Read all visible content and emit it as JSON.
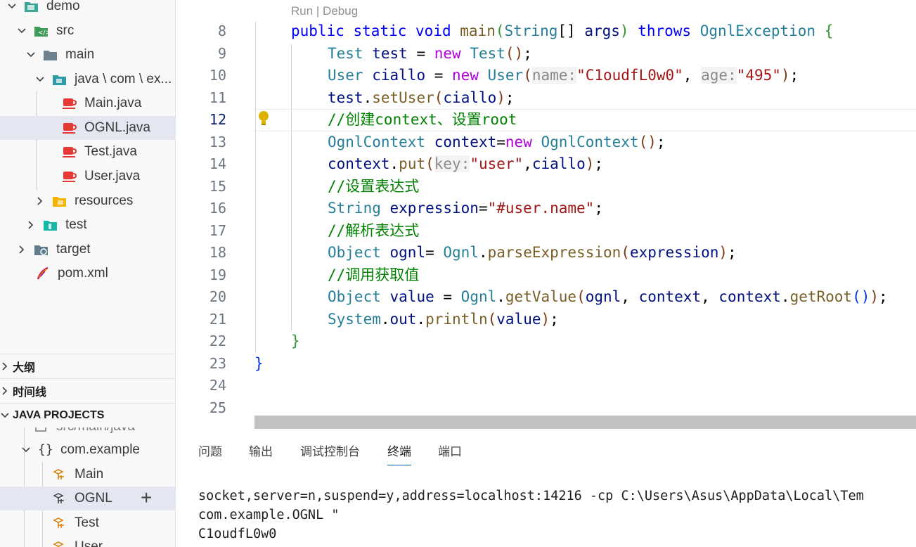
{
  "explorer": {
    "tree": [
      {
        "label": "demo",
        "icon": "folder-open-icon"
      },
      {
        "label": "src",
        "icon": "src-folder-icon"
      },
      {
        "label": "main",
        "icon": "folder-open-icon"
      },
      {
        "label": "java \\ com \\ ex...",
        "icon": "java-folder-icon"
      },
      {
        "label": "Main.java",
        "icon": "java-file-icon"
      },
      {
        "label": "OGNL.java",
        "icon": "java-file-icon"
      },
      {
        "label": "Test.java",
        "icon": "java-file-icon"
      },
      {
        "label": "User.java",
        "icon": "java-file-icon"
      },
      {
        "label": "resources",
        "icon": "resources-folder-icon"
      },
      {
        "label": "test",
        "icon": "test-folder-icon"
      },
      {
        "label": "target",
        "icon": "target-folder-icon"
      },
      {
        "label": "pom.xml",
        "icon": "maven-icon"
      }
    ]
  },
  "sections": {
    "outline": "大纲",
    "timeline": "时间线",
    "java_projects": "JAVA PROJECTS"
  },
  "java_projects": {
    "partial_row": "src/main/java",
    "package": "com.example",
    "classes": [
      "Main",
      "OGNL",
      "Test",
      "User"
    ],
    "add_symbol": "+"
  },
  "editor": {
    "codelens": "Run | Debug",
    "line_numbers": [
      "8",
      "9",
      "10",
      "11",
      "12",
      "13",
      "14",
      "15",
      "16",
      "17",
      "18",
      "19",
      "20",
      "21",
      "22",
      "23",
      "24",
      "25"
    ],
    "active_line": "12",
    "lines": {
      "l8": {
        "kw1": "public",
        "kw2": "static",
        "kw3": "void",
        "name": "main",
        "type": "String",
        "arg": "args",
        "throws": "throws",
        "exc": "OgnlException"
      },
      "l9": {
        "type": "Test",
        "var": "test",
        "new": "new",
        "ctor": "Test"
      },
      "l10": {
        "type": "User",
        "var": "ciallo",
        "new": "new",
        "ctor": "User",
        "hint1": "name:",
        "str1": "\"C1oudfL0w0\"",
        "hint2": "age:",
        "str2": "\"495\""
      },
      "l11": {
        "obj": "test",
        "method": "setUser",
        "arg": "ciallo"
      },
      "l12": {
        "comment": "//创建context、设置root"
      },
      "l13": {
        "type": "OgnlContext",
        "var": "context",
        "new": "new",
        "ctor": "OgnlContext"
      },
      "l14": {
        "obj": "context",
        "method": "put",
        "hint": "key:",
        "str": "\"user\"",
        "arg": "ciallo"
      },
      "l15": {
        "comment": "//设置表达式"
      },
      "l16": {
        "type": "String",
        "var": "expression",
        "str": "\"#user.name\""
      },
      "l17": {
        "comment": "//解析表达式"
      },
      "l18": {
        "type": "Object",
        "var": "ognl",
        "cls": "Ognl",
        "method": "parseExpression",
        "arg": "expression"
      },
      "l19": {
        "comment": "//调用获取值"
      },
      "l20": {
        "type": "Object",
        "var": "value",
        "cls": "Ognl",
        "method": "getValue",
        "a1": "ognl",
        "a2": "context",
        "a3": "context",
        "m2": "getRoot"
      },
      "l21": {
        "cls": "System",
        "field": "out",
        "method": "println",
        "arg": "value"
      }
    }
  },
  "panel": {
    "tabs": [
      "问题",
      "输出",
      "调试控制台",
      "终端",
      "端口"
    ],
    "active_tab": "终端",
    "terminal": [
      "socket,server=n,suspend=y,address=localhost:14216 -cp C:\\Users\\Asus\\AppData\\Local\\Tem",
      "com.example.OGNL \"",
      "C1oudfL0w0"
    ]
  },
  "colors": {
    "keyword": "#0000ff",
    "control_keyword": "#af00db",
    "type": "#267f99",
    "variable": "#001080",
    "function": "#795e26",
    "string": "#a31515",
    "comment": "#008000",
    "selection": "#e4e6f1",
    "tab_underline": "#005fb8"
  }
}
